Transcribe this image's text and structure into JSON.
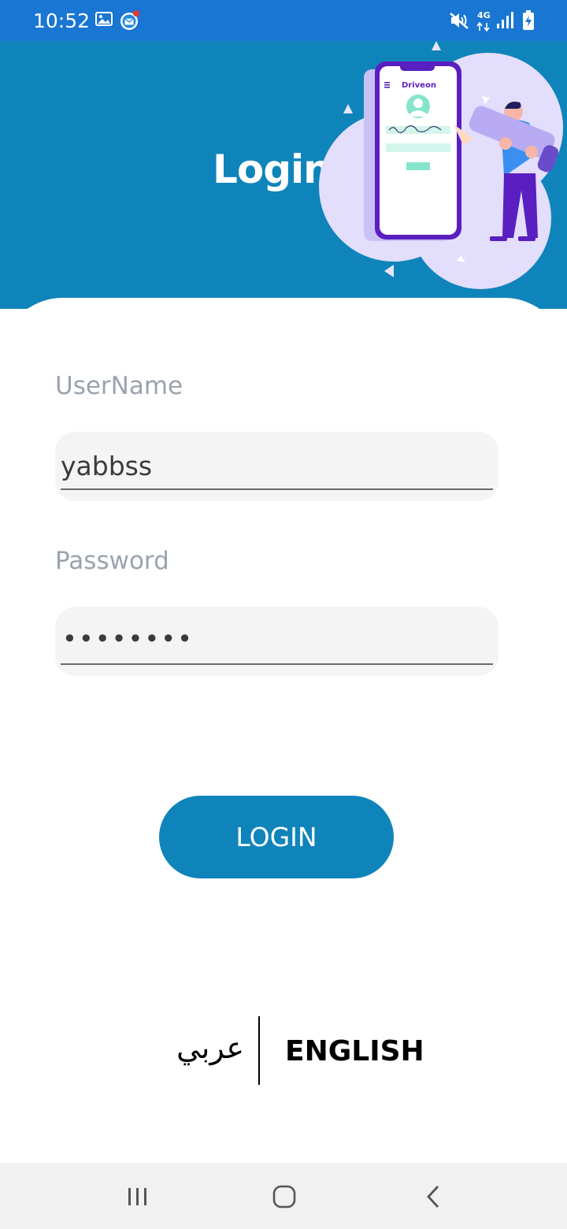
{
  "status_bar": {
    "time": "10:52",
    "network_label": "4G"
  },
  "header": {
    "title": "Login",
    "illustration_brand": "Driveon"
  },
  "form": {
    "username": {
      "label": "UserName",
      "value": "yabbss"
    },
    "password": {
      "label": "Password",
      "masked_value": "••••••••"
    },
    "login_button_label": "LOGIN"
  },
  "language": {
    "arabic_label": "عربي",
    "english_label": "ENGLISH"
  },
  "colors": {
    "status_bar": "#1976d2",
    "header": "#0f84bb",
    "button": "#0f84bb",
    "field_bg": "#f4f4f4",
    "label": "#9aa3ae"
  },
  "icons": {
    "status": [
      "gallery-icon",
      "email-notification-icon",
      "mute-icon",
      "signal-icon",
      "battery-charging-icon"
    ],
    "nav": [
      "recent-apps-icon",
      "home-icon",
      "back-icon"
    ]
  }
}
